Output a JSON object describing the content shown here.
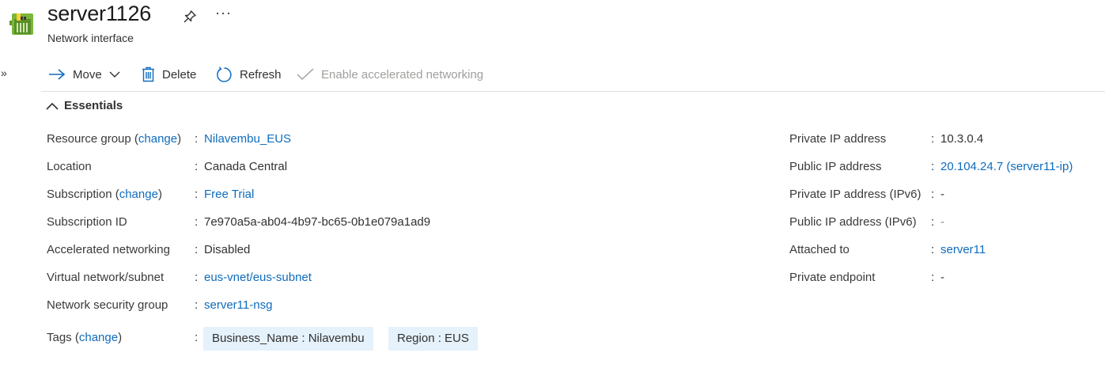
{
  "header": {
    "title": "server1126",
    "subtitle": "Network interface",
    "more_label": "···",
    "expand_label": "»"
  },
  "toolbar": {
    "move": "Move",
    "delete": "Delete",
    "refresh": "Refresh",
    "accelerate": "Enable accelerated networking"
  },
  "essentials": {
    "title": "Essentials",
    "left": {
      "resource_group": {
        "label_pre": "Resource group (",
        "change": "change",
        "label_post": ")",
        "value": "Nilavembu_EUS"
      },
      "location": {
        "label": "Location",
        "value": "Canada Central"
      },
      "subscription": {
        "label_pre": "Subscription (",
        "change": "change",
        "label_post": ")",
        "value": "Free Trial"
      },
      "subscription_id": {
        "label": "Subscription ID",
        "value": "7e970a5a-ab04-4b97-bc65-0b1e079a1ad9"
      },
      "accelerated": {
        "label": "Accelerated networking",
        "value": "Disabled"
      },
      "vnet": {
        "label": "Virtual network/subnet",
        "value": "eus-vnet/eus-subnet"
      },
      "nsg": {
        "label": "Network security group",
        "value": "server11-nsg"
      },
      "tags": {
        "label_pre": "Tags (",
        "change": "change",
        "label_post": ")"
      }
    },
    "right": {
      "private_ip": {
        "label": "Private IP address",
        "value": "10.3.0.4"
      },
      "public_ip": {
        "label": "Public IP address",
        "value": "20.104.24.7 (server11-ip)"
      },
      "private_ipv6": {
        "label": "Private IP address (IPv6)",
        "value": "-"
      },
      "public_ipv6": {
        "label": "Public IP address (IPv6)",
        "value": "-"
      },
      "attached": {
        "label": "Attached to",
        "value": "server11"
      },
      "endpoint": {
        "label": "Private endpoint",
        "value": "-"
      }
    },
    "separator": ":"
  },
  "tags": [
    "Business_Name : Nilavembu",
    "Region : EUS"
  ],
  "colors": {
    "link": "#0f6cbd",
    "tag_bg": "#e5f1fb",
    "disabled": "#a19f9d",
    "divider": "#e1dfdd"
  },
  "icons": {
    "app": "network-interface-icon",
    "pin": "pin-icon",
    "move": "arrow-right-icon",
    "move_dropdown": "chevron-down-icon",
    "delete": "trash-icon",
    "refresh": "refresh-icon",
    "accelerate": "checkmark-icon",
    "collapse": "chevron-up-icon"
  }
}
